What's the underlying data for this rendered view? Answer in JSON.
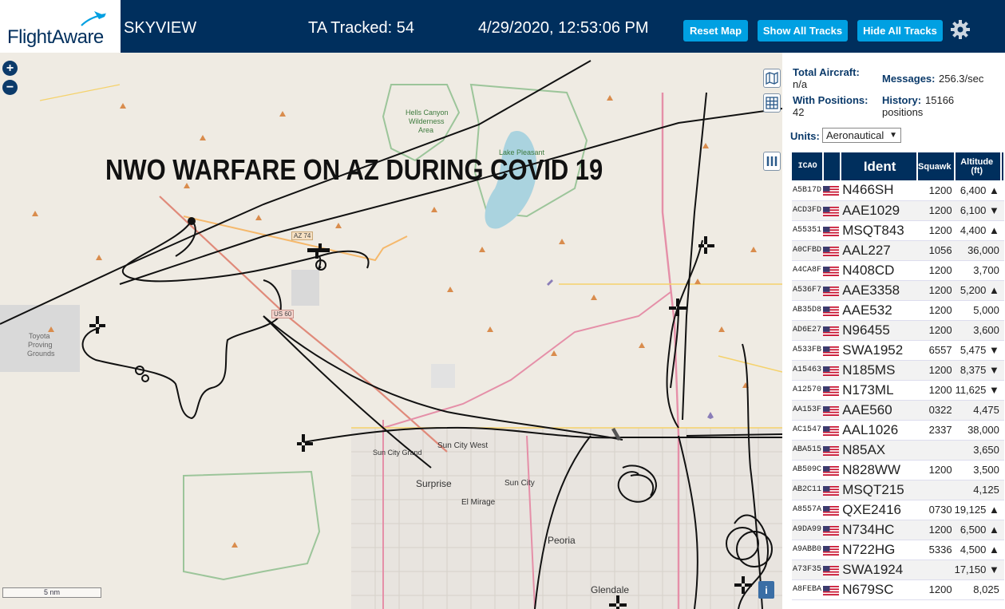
{
  "header": {
    "logo_text": "FlightAware",
    "app_title": "SKYVIEW",
    "tracked": "TA Tracked: 54",
    "datetime": "4/29/2020, 12:53:06 PM",
    "buttons": {
      "reset": "Reset Map",
      "show": "Show All Tracks",
      "hide": "Hide All Tracks"
    }
  },
  "map": {
    "banner": "NWO WARFARE ON AZ DURING COVID 19",
    "zoom_in": "+",
    "zoom_out": "−",
    "scale": "5 nm",
    "info": "i",
    "labels": {
      "hells_canyon": "Hells Canyon",
      "wilderness": "Wilderness",
      "area": "Area",
      "lake_pleasant": "Lake Pleasant",
      "toyota": "Toyota",
      "proving": "Proving",
      "grounds": "Grounds",
      "az74": "AZ 74",
      "us60": "US 60",
      "sun_city_west": "Sun City West",
      "sun_city_grand": "Sun City Grand",
      "surprise": "Surprise",
      "sun_city": "Sun City",
      "el_mirage": "El Mirage",
      "peoria": "Peoria",
      "glendale": "Glendale"
    }
  },
  "stats": {
    "total_label": "Total Aircraft:",
    "total_value": "n/a",
    "positions_label": "With Positions:",
    "positions_value": "42",
    "messages_label": "Messages:",
    "messages_value": "256.3/sec",
    "history_label": "History:",
    "history_value": "15166",
    "history_unit": "positions"
  },
  "units": {
    "label": "Units:",
    "value": "Aeronautical",
    "arrow": "▼"
  },
  "table": {
    "columns": [
      "ICAO",
      "Ident",
      "Squawk",
      "Altitude (ft)"
    ],
    "rows": [
      {
        "icao": "A5B17D",
        "ident": "N466SH",
        "squawk": "1200",
        "alt": "6,400 ▲"
      },
      {
        "icao": "ACD3FD",
        "ident": "AAE1029",
        "squawk": "1200",
        "alt": "6,100 ▼"
      },
      {
        "icao": "A55351",
        "ident": "MSQT843",
        "squawk": "1200",
        "alt": "4,400 ▲"
      },
      {
        "icao": "A0CFBD",
        "ident": "AAL227",
        "squawk": "1056",
        "alt": "36,000"
      },
      {
        "icao": "A4CA8F",
        "ident": "N408CD",
        "squawk": "1200",
        "alt": "3,700"
      },
      {
        "icao": "A536F7",
        "ident": "AAE3358",
        "squawk": "1200",
        "alt": "5,200 ▲"
      },
      {
        "icao": "AB35D8",
        "ident": "AAE532",
        "squawk": "1200",
        "alt": "5,000"
      },
      {
        "icao": "AD6E27",
        "ident": "N96455",
        "squawk": "1200",
        "alt": "3,600"
      },
      {
        "icao": "A533FB",
        "ident": "SWA1952",
        "squawk": "6557",
        "alt": "5,475 ▼"
      },
      {
        "icao": "A15463",
        "ident": "N185MS",
        "squawk": "1200",
        "alt": "8,375 ▼"
      },
      {
        "icao": "A12570",
        "ident": "N173ML",
        "squawk": "1200",
        "alt": "11,625 ▼"
      },
      {
        "icao": "AA153F",
        "ident": "AAE560",
        "squawk": "0322",
        "alt": "4,475"
      },
      {
        "icao": "AC1547",
        "ident": "AAL1026",
        "squawk": "2337",
        "alt": "38,000"
      },
      {
        "icao": "ABA515",
        "ident": "N85AX",
        "squawk": "",
        "alt": "3,650"
      },
      {
        "icao": "AB509C",
        "ident": "N828WW",
        "squawk": "1200",
        "alt": "3,500"
      },
      {
        "icao": "AB2C11",
        "ident": "MSQT215",
        "squawk": "",
        "alt": "4,125"
      },
      {
        "icao": "A8557A",
        "ident": "QXE2416",
        "squawk": "0730",
        "alt": "19,125 ▲"
      },
      {
        "icao": "A9DA99",
        "ident": "N734HC",
        "squawk": "1200",
        "alt": "6,500 ▲"
      },
      {
        "icao": "A9ABB0",
        "ident": "N722HG",
        "squawk": "5336",
        "alt": "4,500 ▲"
      },
      {
        "icao": "A73F35",
        "ident": "SWA1924",
        "squawk": "",
        "alt": "17,150 ▼"
      },
      {
        "icao": "A8FEBA",
        "ident": "N679SC",
        "squawk": "1200",
        "alt": "8,025"
      }
    ]
  },
  "colors": {
    "header_bg": "#002f5d",
    "button_bg": "#00a0e2",
    "map_bg": "#efebe3"
  }
}
